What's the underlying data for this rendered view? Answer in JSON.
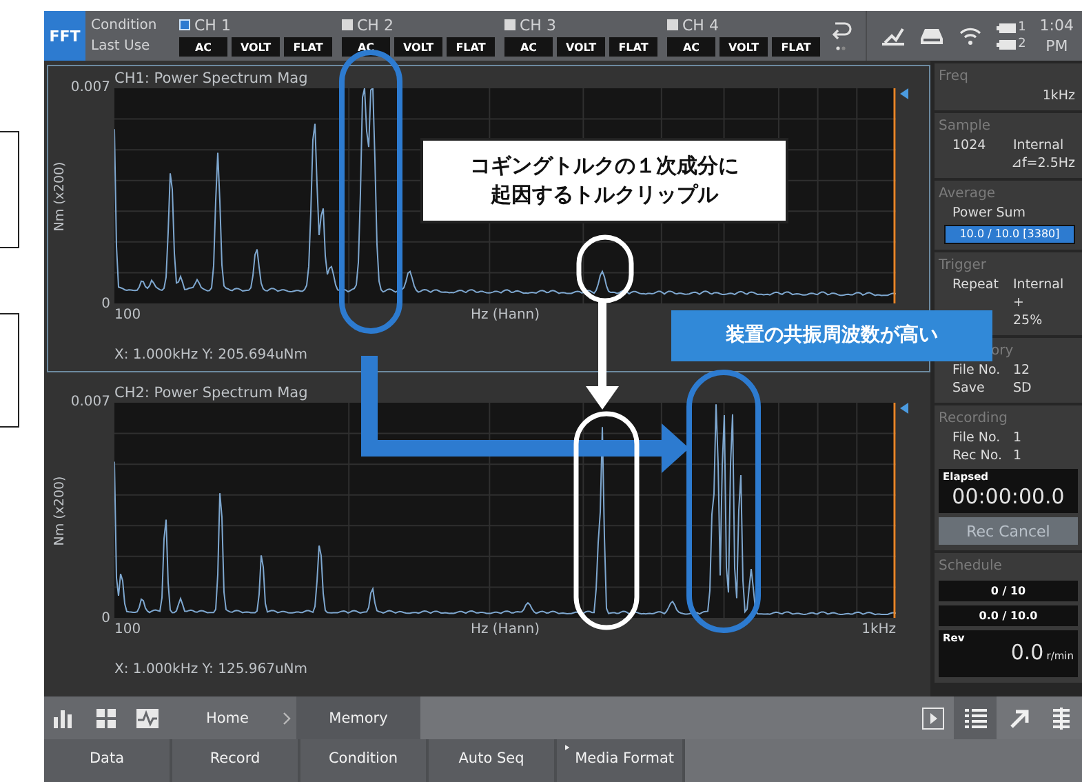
{
  "top_bar": {
    "mode": "FFT",
    "condition_label": "Condition",
    "condition_value": "Last Use",
    "channels": [
      {
        "name": "CH 1",
        "checked": true,
        "settings": [
          "AC",
          "VOLT",
          "FLAT"
        ]
      },
      {
        "name": "CH 2",
        "checked": false,
        "settings": [
          "AC",
          "VOLT",
          "FLAT"
        ]
      },
      {
        "name": "CH 3",
        "checked": false,
        "settings": [
          "AC",
          "VOLT",
          "FLAT"
        ]
      },
      {
        "name": "CH 4",
        "checked": false,
        "settings": [
          "AC",
          "VOLT",
          "FLAT"
        ]
      }
    ],
    "batteries": [
      "1",
      "2"
    ],
    "clock": [
      "1:04",
      "PM"
    ]
  },
  "charts": [
    {
      "title": "CH1: Power Spectrum Mag",
      "selected": true,
      "y_label": "Nm (x200)",
      "y_max": "0.007",
      "y_min": "0",
      "x_min": "100",
      "x_label": "Hz (Hann)",
      "cursor": "X: 1.000kHz Y: 205.694uNm"
    },
    {
      "title": "CH2: Power Spectrum Mag",
      "selected": false,
      "y_label": "Nm (x200)",
      "y_max": "0.007",
      "y_min": "0",
      "x_min": "100",
      "x_label": "Hz (Hann)",
      "x_max": "1kHz",
      "cursor": "X: 1.000kHz Y: 125.967uNm"
    }
  ],
  "side_panel": [
    {
      "title": "Freq",
      "items": [
        {
          "kind": "right",
          "text": "1kHz"
        }
      ]
    },
    {
      "title": "Sample",
      "items": [
        {
          "kind": "pair",
          "label": "1024",
          "value": "Internal"
        },
        {
          "kind": "right",
          "text": "⊿f=2.5Hz"
        }
      ]
    },
    {
      "title": "Average",
      "items": [
        {
          "kind": "text",
          "text": "Power Sum"
        },
        {
          "kind": "bar",
          "text": "10.0 / 10.0 [3380]",
          "level": 1
        }
      ]
    },
    {
      "title": "Trigger",
      "items": [
        {
          "kind": "pair",
          "label": "Repeat",
          "value": "Internal"
        },
        {
          "kind": "value",
          "text": "+"
        },
        {
          "kind": "value",
          "text": "25%"
        }
      ]
    },
    {
      "title": "ory",
      "items": [
        {
          "kind": "pair",
          "label": "File No.",
          "value": "12"
        },
        {
          "kind": "pair",
          "label": "Save",
          "value": "SD"
        }
      ]
    },
    {
      "title": "Recording",
      "items": [
        {
          "kind": "pair",
          "label": "File No.",
          "value": "1"
        },
        {
          "kind": "pair",
          "label": "Rec No.",
          "value": "1"
        },
        {
          "kind": "timer",
          "label": "Elapsed",
          "value": "00:00:00.0"
        },
        {
          "kind": "button",
          "text": "Rec Cancel"
        }
      ]
    },
    {
      "title": "Schedule",
      "items": [
        {
          "kind": "counter",
          "text": "0 / 10"
        },
        {
          "kind": "counter",
          "text": "0.0 / 10.0"
        },
        {
          "kind": "rev",
          "label": "Rev",
          "value": "0.0",
          "unit": "r/min"
        }
      ]
    }
  ],
  "nav_bar": {
    "crumbs": [
      {
        "label": "Home",
        "selected": false
      },
      {
        "label": "Memory",
        "selected": true
      }
    ]
  },
  "menu_tabs": [
    {
      "label": "Data",
      "expandable": false
    },
    {
      "label": "Record",
      "expandable": false
    },
    {
      "label": "Condition",
      "expandable": false
    },
    {
      "label": "Auto Seq",
      "expandable": false
    },
    {
      "label": "Media Format",
      "expandable": true
    }
  ],
  "annotations": [
    {
      "kind": "outlined",
      "lines": [
        "コギングトルクの１次成分に",
        "起因するトルクリップル"
      ]
    },
    {
      "kind": "filled",
      "lines": [
        "装置の共振周波数が高い"
      ]
    }
  ]
}
